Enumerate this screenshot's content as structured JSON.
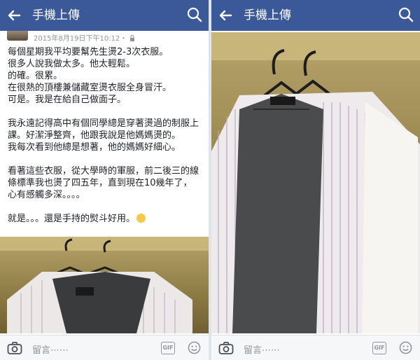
{
  "colors": {
    "topbar": "#3b5998",
    "icon_gray": "#90949c"
  },
  "left_panel": {
    "header": {
      "title": "手機上傳"
    },
    "post": {
      "timestamp": "2015年8月19日下午10:12・",
      "lines": [
        "每個星期我平均要幫先生燙2-3次衣服。",
        "很多人說我做太多。他太輕鬆。",
        "的確。很累。",
        "在很熱的頂樓兼儲藏室燙衣服全身冒汗。",
        "可是。我是在給自己做面子。",
        "我永遠記得高中有個同學總是穿著燙過的制服上",
        "課。好潔淨整齊，他跟我說是他媽媽燙的。",
        "我每次看到他總是想著，他的媽媽好細心。",
        "看著這些衣服，從大學時的軍服，前二後三的線",
        "條標準我也燙了四五年，直到現在10幾年了，",
        "心有感觸多深。。。。",
        "就是。。。還是手持的熨斗好用。"
      ]
    },
    "bottom": {
      "comment_placeholder": "留言⋯⋯",
      "gif_label": "GIF"
    }
  },
  "right_panel": {
    "header": {
      "title": "手機上傳"
    },
    "bottom": {
      "comment_placeholder": "留言⋯⋯",
      "gif_label": "GIF"
    }
  },
  "icons": [
    "back-arrow-icon",
    "search-icon",
    "lock-icon",
    "camera-icon",
    "gif-icon",
    "smiley-icon",
    "grin-emoji-icon"
  ]
}
